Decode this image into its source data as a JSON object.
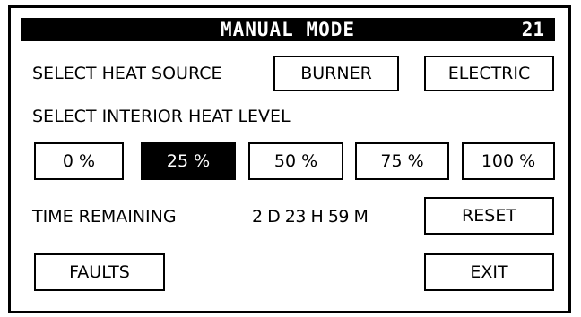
{
  "header": {
    "title": "MANUAL MODE",
    "screen_number": "21"
  },
  "heat_source": {
    "label": "SELECT HEAT SOURCE",
    "burner": "BURNER",
    "electric": "ELECTRIC"
  },
  "heat_level": {
    "label": "SELECT INTERIOR HEAT LEVEL",
    "options": [
      "0 %",
      "25 %",
      "50 %",
      "75 %",
      "100 %"
    ],
    "selected": "25 %"
  },
  "time": {
    "label": "TIME REMAINING",
    "value": "2 D 23 H 59 M",
    "reset": "RESET"
  },
  "footer": {
    "faults": "FAULTS",
    "exit": "EXIT"
  },
  "colors": {
    "foreground": "#000000",
    "background": "#ffffff"
  }
}
